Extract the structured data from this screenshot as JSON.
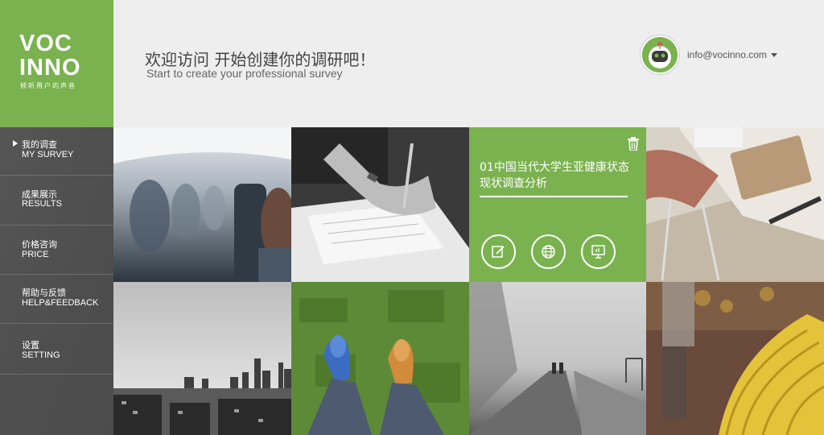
{
  "brand": {
    "logo_line1": "VOC",
    "logo_line2": "INNO",
    "tagline": "倾听用户的声音"
  },
  "header": {
    "welcome_cn": "欢迎访问 开始创建你的调研吧！",
    "welcome_en": "Start to create your professional survey",
    "account_email": "info@vocinno.com"
  },
  "sidebar": {
    "items": [
      {
        "label_cn": "我的调查",
        "label_en": "MY SURVEY",
        "active": true
      },
      {
        "label_cn": "成果展示",
        "label_en": "RESULTS",
        "active": false
      },
      {
        "label_cn": "价格咨询",
        "label_en": "PRICE",
        "active": false
      },
      {
        "label_cn": "帮助与反馈",
        "label_en": "HELP&FEEDBACK",
        "active": false
      },
      {
        "label_cn": "设置",
        "label_en": "SETTING",
        "active": false
      }
    ]
  },
  "survey_card": {
    "title": "01中国当代大学生亚健康状态现状调查分析",
    "actions": [
      {
        "icon": "edit-icon"
      },
      {
        "icon": "globe-icon"
      },
      {
        "icon": "present-icon"
      }
    ],
    "delete_icon": "trash-icon"
  },
  "tiles": [
    {
      "name": "airplane-cabin-photo"
    },
    {
      "name": "writing-hand-photo"
    },
    {
      "name": "desk-workspace-photo"
    },
    {
      "name": "city-skyline-photo"
    },
    {
      "name": "sneakers-on-grass-photo"
    },
    {
      "name": "foggy-walkway-photo"
    },
    {
      "name": "banana-market-photo"
    }
  ],
  "colors": {
    "accent_green": "#7ab24f",
    "sidebar_gray": "#5a5a5a",
    "header_bg": "#eeeeee"
  }
}
